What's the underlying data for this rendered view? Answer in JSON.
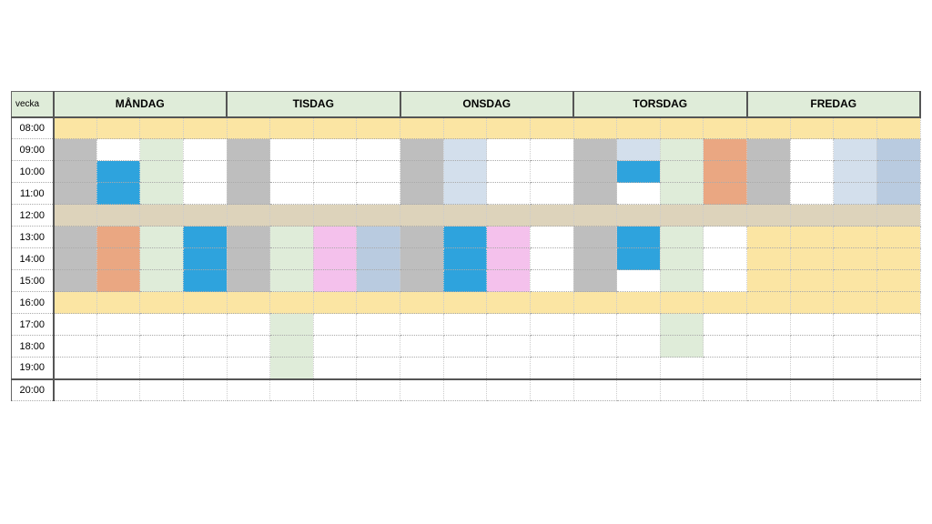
{
  "header": {
    "corner": "vecka",
    "days": [
      "MÅNDAG",
      "TISDAG",
      "ONSDAG",
      "TORSDAG",
      "FREDAG"
    ]
  },
  "hours": [
    "08:00",
    "09:00",
    "10:00",
    "11:00",
    "12:00",
    "13:00",
    "14:00",
    "15:00",
    "16:00",
    "17:00",
    "18:00",
    "19:00",
    "20:00"
  ],
  "subcols_per_day": 4,
  "schedule": {
    "comment": "Each hour row lists 5 days × 4 sub-columns of color classes",
    "08:00": {
      "global": "bg-yellow"
    },
    "09:00": {
      "MÅNDAG": [
        "bg-grey",
        "bg-white",
        "bg-green",
        "bg-white"
      ],
      "TISDAG": [
        "bg-grey",
        "bg-white",
        "bg-white",
        "bg-white"
      ],
      "ONSDAG": [
        "bg-grey",
        "bg-lblue",
        "bg-white",
        "bg-white"
      ],
      "TORSDAG": [
        "bg-grey",
        "bg-lblue",
        "bg-green",
        "bg-orange"
      ],
      "FREDAG": [
        "bg-grey",
        "bg-white",
        "bg-lblue",
        "bg-mblue"
      ]
    },
    "10:00": {
      "MÅNDAG": [
        "bg-grey",
        "bg-blue",
        "bg-green",
        "bg-white"
      ],
      "TISDAG": [
        "bg-grey",
        "bg-white",
        "bg-white",
        "bg-white"
      ],
      "ONSDAG": [
        "bg-grey",
        "bg-lblue",
        "bg-white",
        "bg-white"
      ],
      "TORSDAG": [
        "bg-grey",
        "bg-blue",
        "bg-green",
        "bg-orange"
      ],
      "FREDAG": [
        "bg-grey",
        "bg-white",
        "bg-lblue",
        "bg-mblue"
      ]
    },
    "11:00": {
      "MÅNDAG": [
        "bg-grey",
        "bg-blue",
        "bg-green",
        "bg-white"
      ],
      "TISDAG": [
        "bg-grey",
        "bg-white",
        "bg-white",
        "bg-white"
      ],
      "ONSDAG": [
        "bg-grey",
        "bg-lblue",
        "bg-white",
        "bg-white"
      ],
      "TORSDAG": [
        "bg-grey",
        "bg-white",
        "bg-green",
        "bg-orange"
      ],
      "FREDAG": [
        "bg-grey",
        "bg-white",
        "bg-lblue",
        "bg-mblue"
      ]
    },
    "12:00": {
      "global": "bg-tan"
    },
    "13:00": {
      "MÅNDAG": [
        "bg-grey",
        "bg-orange",
        "bg-green",
        "bg-blue"
      ],
      "TISDAG": [
        "bg-grey",
        "bg-green",
        "bg-pink",
        "bg-mblue"
      ],
      "ONSDAG": [
        "bg-grey",
        "bg-blue",
        "bg-pink",
        "bg-white"
      ],
      "TORSDAG": [
        "bg-grey",
        "bg-blue",
        "bg-green",
        "bg-white"
      ],
      "FREDAG": [
        "bg-yellow",
        "bg-yellow",
        "bg-yellow",
        "bg-yellow"
      ]
    },
    "14:00": {
      "MÅNDAG": [
        "bg-grey",
        "bg-orange",
        "bg-green",
        "bg-blue"
      ],
      "TISDAG": [
        "bg-grey",
        "bg-green",
        "bg-pink",
        "bg-mblue"
      ],
      "ONSDAG": [
        "bg-grey",
        "bg-blue",
        "bg-pink",
        "bg-white"
      ],
      "TORSDAG": [
        "bg-grey",
        "bg-blue",
        "bg-green",
        "bg-white"
      ],
      "FREDAG": [
        "bg-yellow",
        "bg-yellow",
        "bg-yellow",
        "bg-yellow"
      ]
    },
    "15:00": {
      "MÅNDAG": [
        "bg-grey",
        "bg-orange",
        "bg-green",
        "bg-blue"
      ],
      "TISDAG": [
        "bg-grey",
        "bg-green",
        "bg-pink",
        "bg-mblue"
      ],
      "ONSDAG": [
        "bg-grey",
        "bg-blue",
        "bg-pink",
        "bg-white"
      ],
      "TORSDAG": [
        "bg-grey",
        "bg-white",
        "bg-green",
        "bg-white"
      ],
      "FREDAG": [
        "bg-yellow",
        "bg-yellow",
        "bg-yellow",
        "bg-yellow"
      ]
    },
    "16:00": {
      "global": "bg-yellow"
    },
    "17:00": {
      "MÅNDAG": [
        "bg-white",
        "bg-white",
        "bg-white",
        "bg-white"
      ],
      "TISDAG": [
        "bg-white",
        "bg-green",
        "bg-white",
        "bg-white"
      ],
      "ONSDAG": [
        "bg-white",
        "bg-white",
        "bg-white",
        "bg-white"
      ],
      "TORSDAG": [
        "bg-white",
        "bg-white",
        "bg-green",
        "bg-white"
      ],
      "FREDAG": [
        "bg-white",
        "bg-white",
        "bg-white",
        "bg-white"
      ]
    },
    "18:00": {
      "MÅNDAG": [
        "bg-white",
        "bg-white",
        "bg-white",
        "bg-white"
      ],
      "TISDAG": [
        "bg-white",
        "bg-green",
        "bg-white",
        "bg-white"
      ],
      "ONSDAG": [
        "bg-white",
        "bg-white",
        "bg-white",
        "bg-white"
      ],
      "TORSDAG": [
        "bg-white",
        "bg-white",
        "bg-green",
        "bg-white"
      ],
      "FREDAG": [
        "bg-white",
        "bg-white",
        "bg-white",
        "bg-white"
      ]
    },
    "19:00": {
      "MÅNDAG": [
        "bg-white",
        "bg-white",
        "bg-white",
        "bg-white"
      ],
      "TISDAG": [
        "bg-white",
        "bg-green",
        "bg-white",
        "bg-white"
      ],
      "ONSDAG": [
        "bg-white",
        "bg-white",
        "bg-white",
        "bg-white"
      ],
      "TORSDAG": [
        "bg-white",
        "bg-white",
        "bg-white",
        "bg-white"
      ],
      "FREDAG": [
        "bg-white",
        "bg-white",
        "bg-white",
        "bg-white"
      ]
    },
    "20:00": {
      "global": "bg-white"
    }
  }
}
